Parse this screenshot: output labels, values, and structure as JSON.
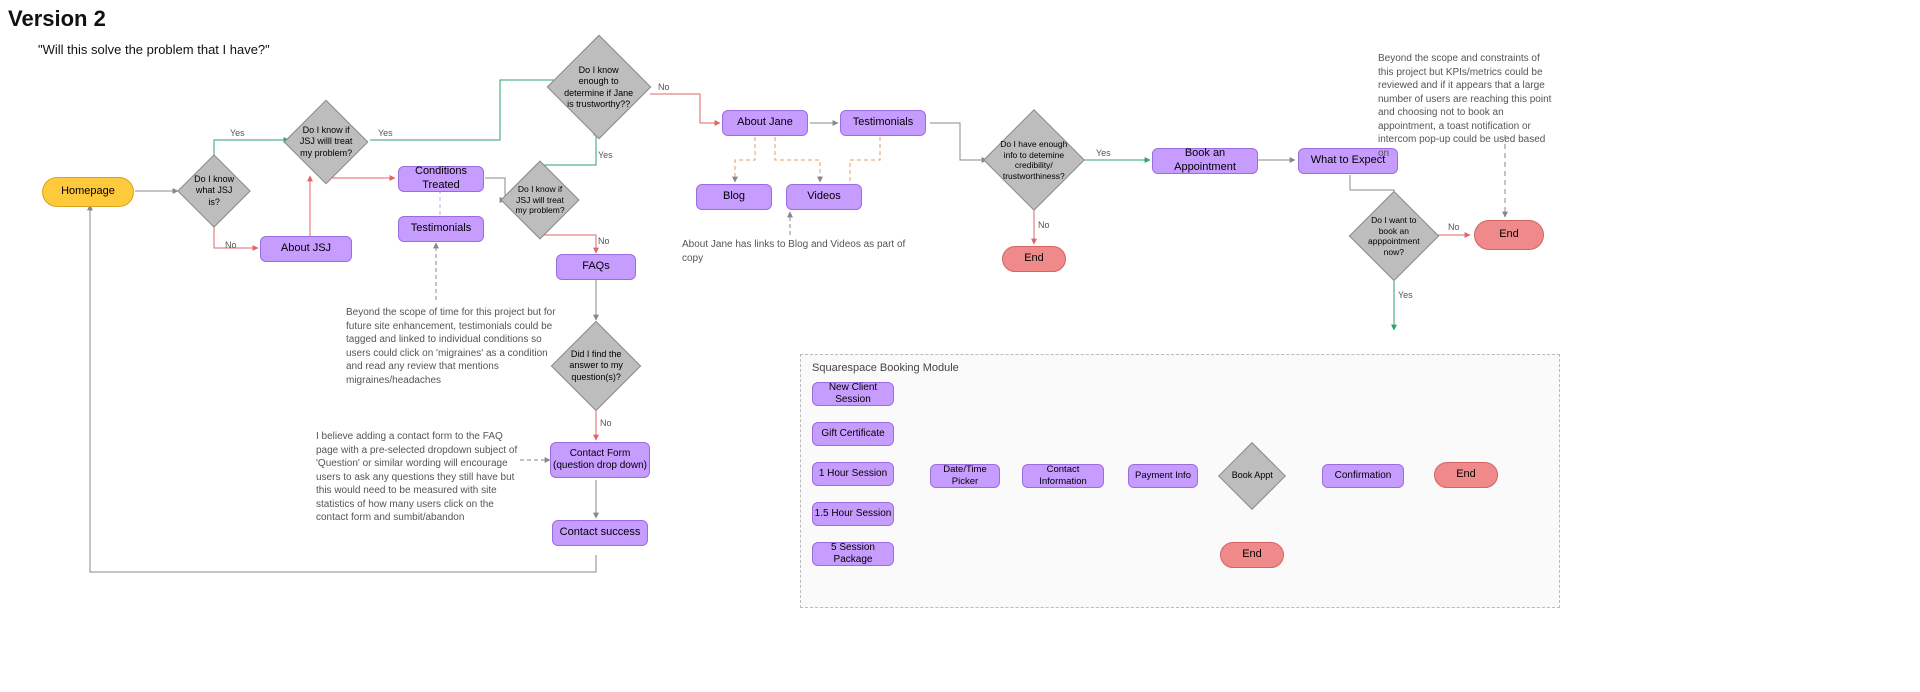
{
  "chart_data": {
    "type": "diagram",
    "subtype": "flowchart",
    "title": "Version 2",
    "question": "\"Will this solve the problem that I have?\"",
    "nodes": [
      {
        "id": "homepage",
        "type": "start",
        "label": "Homepage"
      },
      {
        "id": "d_know_jsj",
        "type": "decision",
        "label": "Do I know what JSJ is?"
      },
      {
        "id": "about_jsj",
        "type": "action",
        "label": "About JSJ"
      },
      {
        "id": "d_jsj_treat",
        "type": "decision",
        "label": "Do I know if JSJ willl treat my problem?"
      },
      {
        "id": "conditions",
        "type": "action",
        "label": "Conditions Treated"
      },
      {
        "id": "testimonials1",
        "type": "action",
        "label": "Testimonials"
      },
      {
        "id": "d_jsj_treat2",
        "type": "decision",
        "label": "Do I know if JSJ will treat my problem?"
      },
      {
        "id": "d_trustworthy",
        "type": "decision",
        "label": "Do I know enough to determine if Jane is trustworthy??"
      },
      {
        "id": "faqs",
        "type": "action",
        "label": "FAQs"
      },
      {
        "id": "d_found_answer",
        "type": "decision",
        "label": "Did I find the answer to my question(s)?"
      },
      {
        "id": "contact_form",
        "type": "action",
        "label": "Contact Form (question drop down)"
      },
      {
        "id": "contact_success",
        "type": "action",
        "label": "Contact success"
      },
      {
        "id": "about_jane",
        "type": "action",
        "label": "About Jane"
      },
      {
        "id": "testimonials2",
        "type": "action",
        "label": "Testimonials"
      },
      {
        "id": "blog",
        "type": "action",
        "label": "Blog"
      },
      {
        "id": "videos",
        "type": "action",
        "label": "Videos"
      },
      {
        "id": "d_credibility",
        "type": "decision",
        "label": "Do I have enough info to detemine credibility/ trustworthiness?"
      },
      {
        "id": "end1",
        "type": "terminal",
        "label": "End"
      },
      {
        "id": "book_appt_page",
        "type": "action",
        "label": "Book an Appointment"
      },
      {
        "id": "what_expect",
        "type": "action",
        "label": "What to Expect"
      },
      {
        "id": "d_book_now",
        "type": "decision",
        "label": "Do I want to book an apppointment now?"
      },
      {
        "id": "end2",
        "type": "terminal",
        "label": "End"
      },
      {
        "id": "new_client",
        "type": "action",
        "label": "New Client Session"
      },
      {
        "id": "gift_cert",
        "type": "action",
        "label": "Gift Certificate"
      },
      {
        "id": "session_1h",
        "type": "action",
        "label": "1 Hour Session"
      },
      {
        "id": "session_1_5h",
        "type": "action",
        "label": "1.5 Hour Session"
      },
      {
        "id": "session_5pkg",
        "type": "action",
        "label": "5 Session Package"
      },
      {
        "id": "datetime",
        "type": "action",
        "label": "Date/Time Picker"
      },
      {
        "id": "contact_info",
        "type": "action",
        "label": "Contact Information"
      },
      {
        "id": "payment",
        "type": "action",
        "label": "Payment Info"
      },
      {
        "id": "d_book",
        "type": "decision",
        "label": "Book Appt"
      },
      {
        "id": "confirmation",
        "type": "action",
        "label": "Confirmation"
      },
      {
        "id": "end3",
        "type": "terminal",
        "label": "End"
      },
      {
        "id": "end4",
        "type": "terminal",
        "label": "End"
      }
    ],
    "edges": [
      {
        "from": "homepage",
        "to": "d_know_jsj"
      },
      {
        "from": "d_know_jsj",
        "to": "d_jsj_treat",
        "label": "Yes"
      },
      {
        "from": "d_know_jsj",
        "to": "about_jsj",
        "label": "No"
      },
      {
        "from": "about_jsj",
        "to": "d_jsj_treat"
      },
      {
        "from": "d_jsj_treat",
        "to": "d_trustworthy",
        "label": "Yes"
      },
      {
        "from": "d_jsj_treat",
        "to": "conditions",
        "label": "No"
      },
      {
        "from": "conditions",
        "to": "testimonials1",
        "style": "dashed"
      },
      {
        "from": "conditions",
        "to": "d_jsj_treat2"
      },
      {
        "from": "d_jsj_treat2",
        "to": "d_trustworthy",
        "label": "Yes"
      },
      {
        "from": "d_jsj_treat2",
        "to": "faqs",
        "label": "No"
      },
      {
        "from": "faqs",
        "to": "d_found_answer"
      },
      {
        "from": "d_found_answer",
        "to": "homepage",
        "label": "Yes"
      },
      {
        "from": "d_found_answer",
        "to": "contact_form",
        "label": "No"
      },
      {
        "from": "contact_form",
        "to": "contact_success"
      },
      {
        "from": "d_trustworthy",
        "to": "about_jane",
        "label": "No"
      },
      {
        "from": "about_jane",
        "to": "testimonials2"
      },
      {
        "from": "about_jane",
        "to": "blog",
        "style": "dashed"
      },
      {
        "from": "about_jane",
        "to": "videos",
        "style": "dashed"
      },
      {
        "from": "testimonials2",
        "to": "d_credibility"
      },
      {
        "from": "d_credibility",
        "to": "end1",
        "label": "No"
      },
      {
        "from": "d_credibility",
        "to": "book_appt_page",
        "label": "Yes"
      },
      {
        "from": "book_appt_page",
        "to": "what_expect"
      },
      {
        "from": "what_expect",
        "to": "d_book_now"
      },
      {
        "from": "d_book_now",
        "to": "end2",
        "label": "No"
      },
      {
        "from": "d_book_now",
        "to": "module",
        "label": "Yes"
      },
      {
        "from": "datetime",
        "to": "contact_info"
      },
      {
        "from": "contact_info",
        "to": "payment"
      },
      {
        "from": "payment",
        "to": "d_book"
      },
      {
        "from": "d_book",
        "to": "confirmation",
        "label": "Yes"
      },
      {
        "from": "confirmation",
        "to": "end3"
      },
      {
        "from": "d_book",
        "to": "end4",
        "label": "No"
      }
    ],
    "module": {
      "label": "Squarespace Booking Module"
    },
    "notes": {
      "n1": "Beyond the scope of time for this project but for future site enhancement, testimonials could be tagged and linked to individual conditions so users could click on 'migraines' as a condition and read any review that mentions migraines/headaches",
      "n2": "I believe adding a contact form to the FAQ page with a pre-selected dropdown subject of 'Question' or similar wording will encourage users to ask any questions they still have but this would need to be measured with site statistics of how many users click on the contact form and sumbit/abandon",
      "n3": "About Jane has links to Blog and Videos as part of copy",
      "n4": "Beyond the scope and constraints of this project but KPIs/metrics could be reviewed and if it appears that a large number of users are reaching this point and choosing not to book an appointment,  a toast notification or intercom pop-up could be used based on"
    },
    "edge_labels": {
      "yes": "Yes",
      "no": "No"
    }
  }
}
